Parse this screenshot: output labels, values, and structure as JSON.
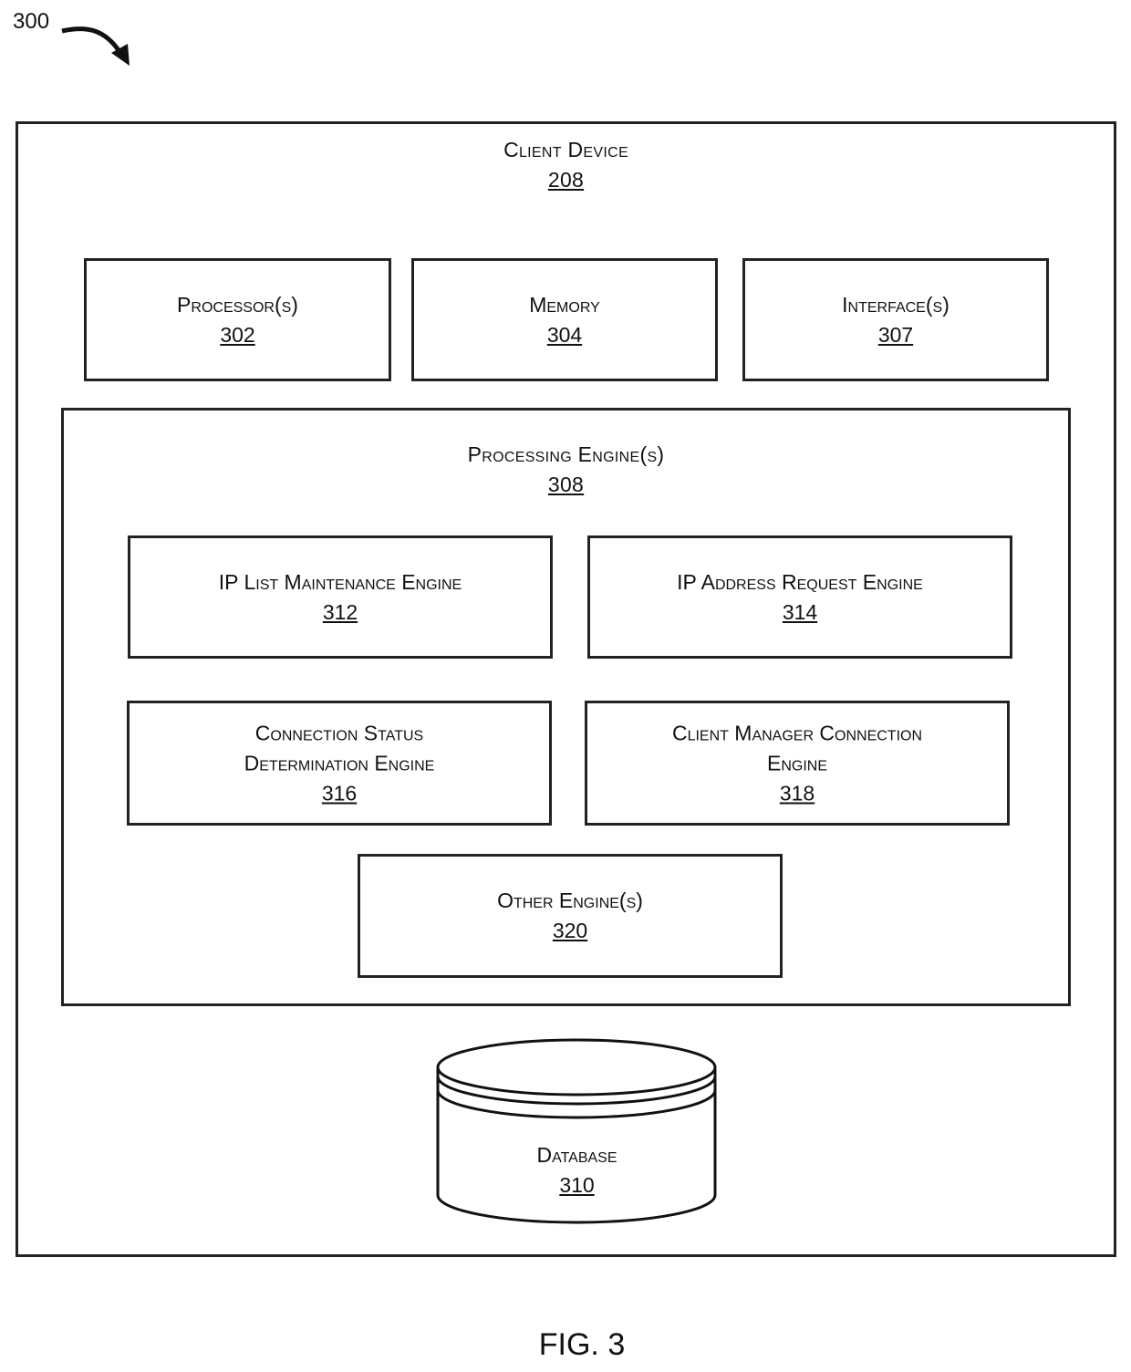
{
  "figure_ref": "300",
  "caption": "FIG. 3",
  "client_device": {
    "title": "Client Device",
    "number": "208"
  },
  "top_components": [
    {
      "title": "Processor(s)",
      "number": "302"
    },
    {
      "title": "Memory",
      "number": "304"
    },
    {
      "title": "Interface(s)",
      "number": "307"
    }
  ],
  "processing_engines": {
    "title": "Processing Engine(s)",
    "number": "308",
    "engines": [
      {
        "line1": "IP List Maintenance Engine",
        "line2": "",
        "number": "312"
      },
      {
        "line1": "IP Address Request Engine",
        "line2": "",
        "number": "314"
      },
      {
        "line1": "Connection Status",
        "line2": "Determination Engine",
        "number": "316"
      },
      {
        "line1": "Client Manager Connection",
        "line2": "Engine",
        "number": "318"
      },
      {
        "line1": "Other Engine(s)",
        "line2": "",
        "number": "320"
      }
    ]
  },
  "database": {
    "title": "Database",
    "number": "310"
  }
}
